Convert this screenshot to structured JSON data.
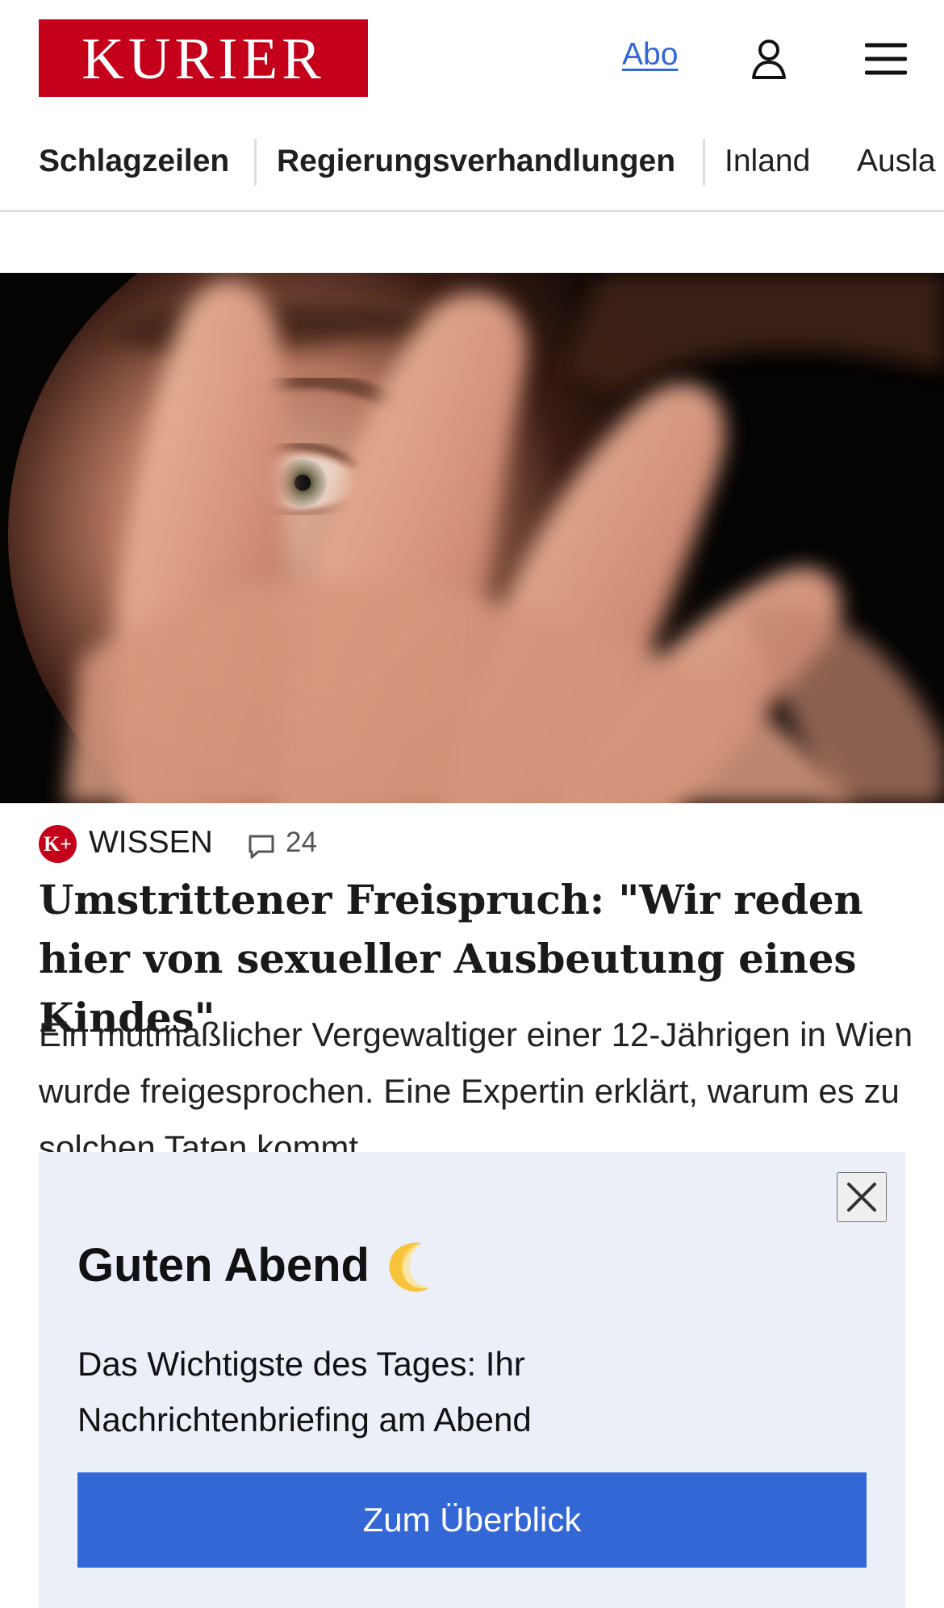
{
  "header": {
    "logo_text": "KURIER",
    "abo_label": "Abo",
    "account_icon": "user-icon",
    "menu_icon": "menu-icon"
  },
  "nav": {
    "items": [
      {
        "label": "Schlagzeilen"
      },
      {
        "label": "Regierungsverhandlungen"
      },
      {
        "label": "Inland"
      },
      {
        "label": "Ausla"
      }
    ]
  },
  "article": {
    "image_description": "close-up of a person with a blurred raised hand covering part of the face",
    "badge_text": "K+",
    "section": "WISSEN",
    "comment_icon": "comment-icon",
    "comment_count": "24",
    "headline": "Umstrittener Freispruch: \"Wir reden hier von sexueller Ausbeutung eines Kindes\"",
    "teaser": "Ein mutmaßlicher Vergewaltiger einer 12-Jährigen in Wien wurde freigesprochen. Eine Expertin erklärt, warum es zu solchen Taten kommt."
  },
  "briefing": {
    "close_icon": "close-icon",
    "greeting": "Guten Abend",
    "moon_icon": "crescent-moon-icon",
    "text": "Das Wichtigste des Tages: Ihr Nachrichtenbriefing am Abend",
    "button_label": "Zum Überblick"
  },
  "colors": {
    "brand": "#c4001a",
    "link": "#3467d6",
    "overlay_background": "#ebeff8",
    "button_background": "#3467d6"
  }
}
